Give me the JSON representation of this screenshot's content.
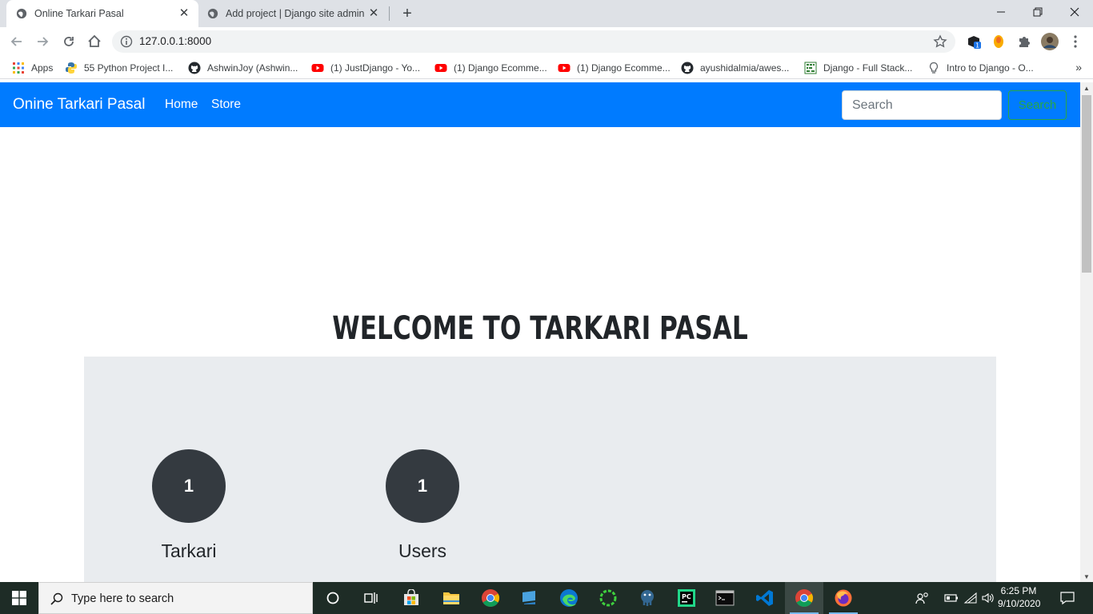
{
  "browser": {
    "tabs": [
      {
        "title": "Online Tarkari Pasal",
        "active": true
      },
      {
        "title": "Add project | Django site admin",
        "active": false
      }
    ],
    "url": "127.0.0.1:8000",
    "bookmarks": [
      {
        "label": "Apps",
        "icon": "apps-grid-icon"
      },
      {
        "label": "55 Python Project I...",
        "icon": "python-icon"
      },
      {
        "label": "AshwinJoy (Ashwin...",
        "icon": "github-icon"
      },
      {
        "label": "(1) JustDjango - Yo...",
        "icon": "youtube-icon"
      },
      {
        "label": "(1) Django Ecomme...",
        "icon": "youtube-icon"
      },
      {
        "label": "(1) Django Ecomme...",
        "icon": "youtube-icon"
      },
      {
        "label": "ayushidalmia/awes...",
        "icon": "github-icon"
      },
      {
        "label": "Django - Full Stack...",
        "icon": "fullstack-icon"
      },
      {
        "label": "Intro to Django - O...",
        "icon": "lightbulb-icon"
      }
    ],
    "bookmarks_more": "»"
  },
  "site": {
    "brand": "Onine Tarkari Pasal",
    "nav_links": [
      "Home",
      "Store"
    ],
    "search_placeholder": "Search",
    "search_button": "Search",
    "heading": "WELCOME TO TARKARI PASAL",
    "stats": [
      {
        "value": "1",
        "label": "Tarkari"
      },
      {
        "value": "1",
        "label": "Users"
      }
    ]
  },
  "taskbar": {
    "search_placeholder": "Type here to search",
    "time": "6:25 PM",
    "date": "9/10/2020"
  },
  "colors": {
    "navbar": "#007bff",
    "search_button": "#28a745",
    "stat_circle": "#343a40",
    "panel": "#e9ecef",
    "taskbar": "#1e2c26"
  }
}
